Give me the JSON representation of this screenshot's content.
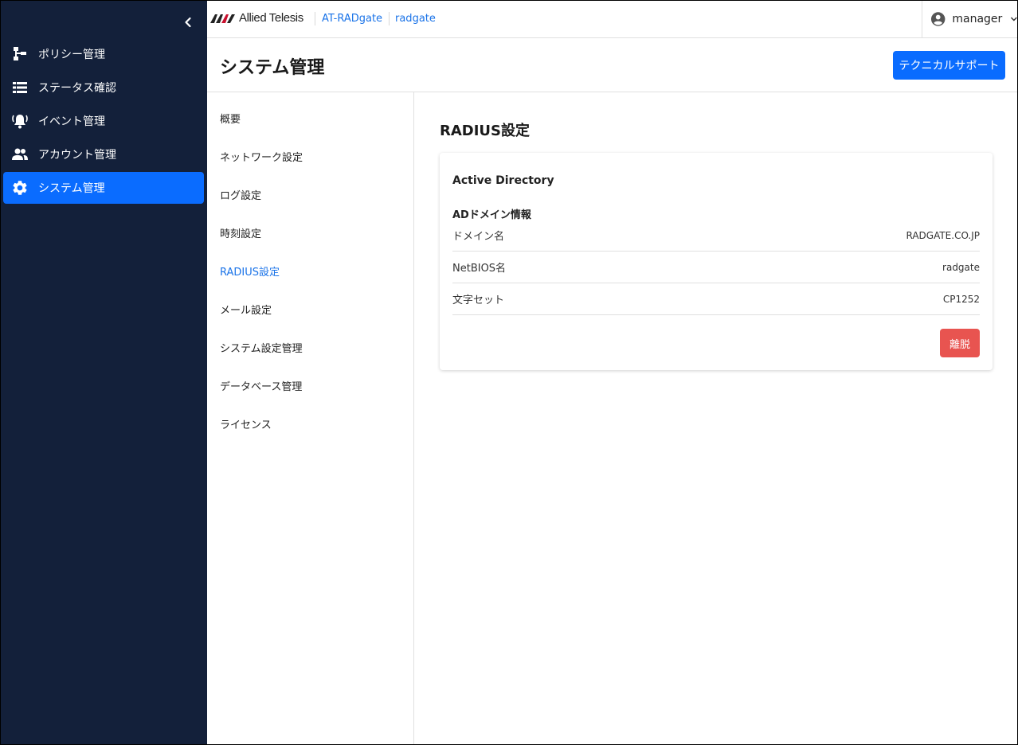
{
  "topbar": {
    "brand": "Allied Telesis",
    "crumbs": [
      "AT-RADgate",
      "radgate"
    ],
    "user": "manager"
  },
  "sidebar": {
    "items": [
      {
        "label": "ポリシー管理",
        "icon": "policy-tree-icon"
      },
      {
        "label": "ステータス確認",
        "icon": "list-icon"
      },
      {
        "label": "イベント管理",
        "icon": "alarm-bell-icon"
      },
      {
        "label": "アカウント管理",
        "icon": "people-icon"
      },
      {
        "label": "システム管理",
        "icon": "gear-icon",
        "active": true
      }
    ]
  },
  "header": {
    "title": "システム管理",
    "support_button": "テクニカルサポート"
  },
  "submenu": {
    "items": [
      "概要",
      "ネットワーク設定",
      "ログ設定",
      "時刻設定",
      "RADIUS設定",
      "メール設定",
      "システム設定管理",
      "データベース管理",
      "ライセンス"
    ],
    "active": "RADIUS設定"
  },
  "content": {
    "section_title": "RADIUS設定",
    "card": {
      "title": "Active Directory",
      "subtitle": "ADドメイン情報",
      "rows": [
        {
          "label": "ドメイン名",
          "value": "RADGATE.CO.JP"
        },
        {
          "label": "NetBIOS名",
          "value": "radgate"
        },
        {
          "label": "文字セット",
          "value": "CP1252"
        }
      ],
      "leave_button": "離脱"
    }
  },
  "colors": {
    "sidebar_bg": "#13203a",
    "accent": "#0a6cff",
    "link": "#1a73e8",
    "danger": "#e85450"
  }
}
